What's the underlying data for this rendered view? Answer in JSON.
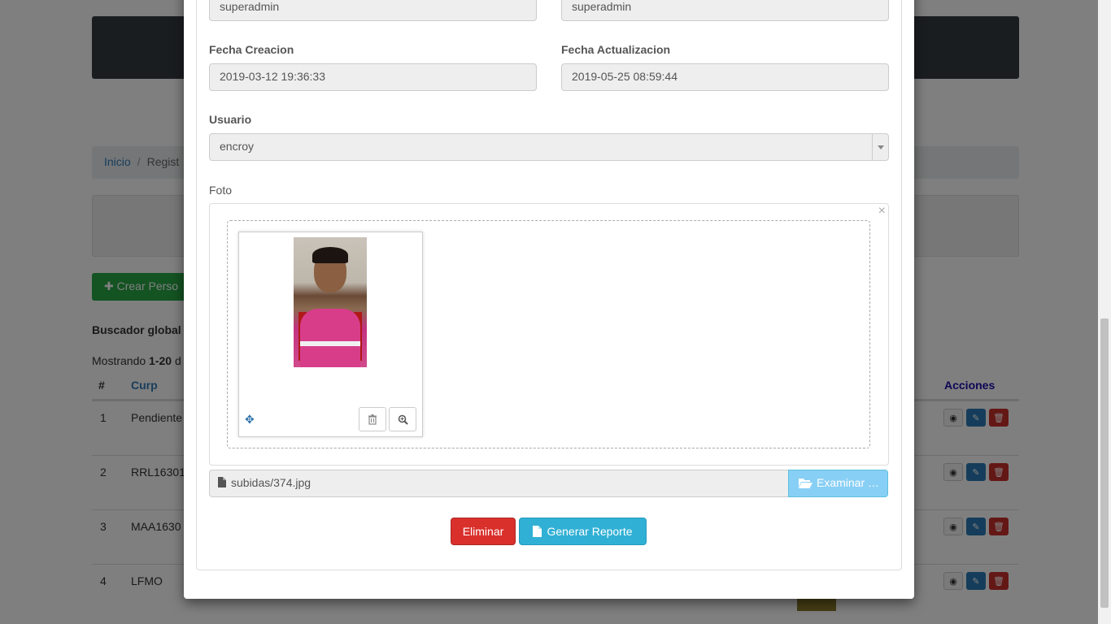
{
  "background": {
    "breadcrumb": {
      "home": "Inicio",
      "separator": "/",
      "current": "Regist"
    },
    "create_button": "Crear Perso",
    "search_label": "Buscador global",
    "showing": {
      "prefix": "Mostrando ",
      "range": "1-20",
      "suffix": " d"
    },
    "table": {
      "headers": {
        "num": "#",
        "curp": "Curp",
        "actions": "Acciones"
      },
      "rows": [
        {
          "num": "1",
          "curp": "Pendiente"
        },
        {
          "num": "2",
          "curp": "RRL16301"
        },
        {
          "num": "3",
          "curp": "MAA1630"
        },
        {
          "num": "4",
          "curp": "LFMO"
        }
      ]
    }
  },
  "modal": {
    "created_by": "superadmin",
    "updated_by": "superadmin",
    "fecha_creacion": {
      "label": "Fecha Creacion",
      "value": "2019-03-12 19:36:33"
    },
    "fecha_actualizacion": {
      "label": "Fecha Actualizacion",
      "value": "2019-05-25 08:59:44"
    },
    "usuario": {
      "label": "Usuario",
      "value": "encroy"
    },
    "foto": {
      "label": "Foto",
      "close": "×",
      "file_name": "subidas/374.jpg",
      "browse_label": "Examinar …"
    },
    "buttons": {
      "delete": "Eliminar",
      "report": "Generar Reporte"
    }
  },
  "icons": {
    "move": "move-icon",
    "trash": "trash-icon",
    "zoom": "zoom-in-icon",
    "file": "file-icon",
    "folder": "folder-open-icon",
    "eye": "eye-icon",
    "pencil": "pencil-icon"
  },
  "colors": {
    "danger": "#d9302c",
    "info": "#31b0d5",
    "primary_link": "#337ab7",
    "success": "#28a745"
  }
}
